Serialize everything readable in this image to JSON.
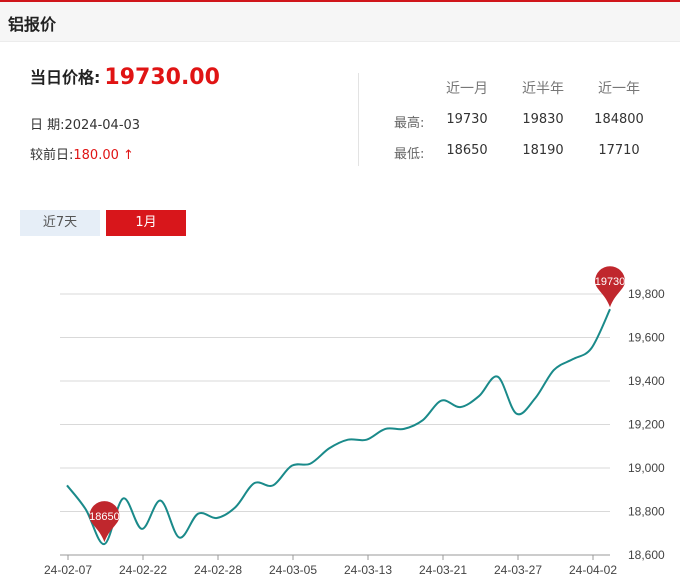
{
  "page": {
    "title": "铝报价",
    "price_label": "当日价格:",
    "price_value": "19730.00",
    "date_label": "日 期:",
    "date_value": "2024-04-03",
    "change_label": "较前日:",
    "change_value": "180.00",
    "change_arrow": "↑"
  },
  "stats": {
    "headers": [
      "近一月",
      "近半年",
      "近一年"
    ],
    "rows": [
      {
        "label": "最高:",
        "values": [
          "19730",
          "19830",
          "184800"
        ]
      },
      {
        "label": "最低:",
        "values": [
          "18650",
          "18190",
          "17710"
        ]
      }
    ]
  },
  "tabs": [
    {
      "label": "近7天",
      "active": false
    },
    {
      "label": "1月",
      "active": true
    }
  ],
  "colors": {
    "accent": "#d8161b",
    "line": "#1a8a8a",
    "pin": "#c0272d",
    "tab_inactive_bg": "#e6eef7"
  },
  "chart_data": {
    "type": "line",
    "x_ticks": [
      "24-02-07",
      "24-02-22",
      "24-02-28",
      "24-03-05",
      "24-03-13",
      "24-03-21",
      "24-03-27",
      "24-04-02"
    ],
    "y_ticks": [
      "18,600",
      "18,800",
      "19,000",
      "19,200",
      "19,400",
      "19,600",
      "19,800"
    ],
    "ylim": [
      18600,
      19840
    ],
    "grid": true,
    "series": [
      {
        "values": [
          18920,
          18810,
          18650,
          18860,
          18720,
          18850,
          18680,
          18790,
          18770,
          18820,
          18930,
          18920,
          19010,
          19020,
          19090,
          19130,
          19130,
          19180,
          19180,
          19220,
          19310,
          19280,
          19330,
          19420,
          19250,
          19320,
          19450,
          19500,
          19550,
          19730
        ]
      }
    ],
    "annotations": [
      {
        "label": "18650",
        "value": 18650,
        "index": 2
      },
      {
        "label": "19730",
        "value": 19730,
        "index": 29
      }
    ]
  }
}
